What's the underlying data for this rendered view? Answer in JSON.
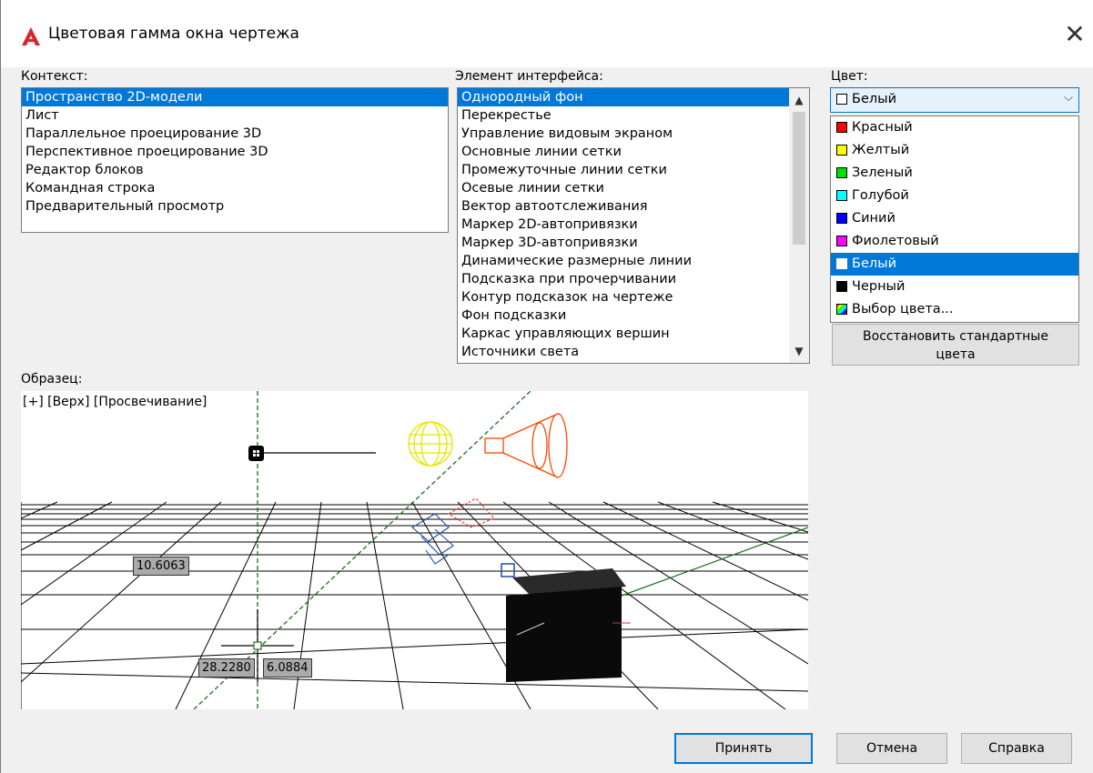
{
  "window": {
    "title": "Цветовая гамма окна чертежа",
    "close_glyph": "✕",
    "app_icon": "autocad-logo-icon",
    "accent": "#0078d7"
  },
  "context": {
    "label": "Контекст:",
    "items": [
      "Пространство 2D-модели",
      "Лист",
      "Параллельное проецирование 3D",
      "Перспективное проецирование 3D",
      "Редактор блоков",
      "Командная строка",
      "Предварительный просмотр"
    ],
    "selected_index": 0
  },
  "interface_element": {
    "label": "Элемент интерфейса:",
    "items": [
      "Однородный фон",
      "Перекрестье",
      "Управление видовым экраном",
      "Основные линии сетки",
      "Промежуточные линии сетки",
      "Осевые линии сетки",
      "Вектор автоотслеживания",
      "Маркер 2D-автопривязки",
      "Маркер 3D-автопривязки",
      "Динамические размерные линии",
      "Подсказка при прочерчивании",
      "Контур подсказок на чертеже",
      "Фон подсказки",
      "Каркас управляющих вершин",
      "Источники света"
    ],
    "selected_index": 0
  },
  "color": {
    "label": "Цвет:",
    "selected_value": "Белый",
    "options": [
      {
        "name": "Красный",
        "color": "#ff0000"
      },
      {
        "name": "Желтый",
        "color": "#ffff00"
      },
      {
        "name": "Зеленый",
        "color": "#00e000"
      },
      {
        "name": "Голубой",
        "color": "#00ffff"
      },
      {
        "name": "Синий",
        "color": "#0000ff"
      },
      {
        "name": "Фиолетовый",
        "color": "#ff00ff"
      },
      {
        "name": "Белый",
        "color": "#ffffff"
      },
      {
        "name": "Черный",
        "color": "#000000"
      },
      {
        "name": "Выбор цвета...",
        "color": "multicolor"
      }
    ],
    "highlighted_index": 6
  },
  "restore_button": {
    "line1": "Восстановить стандартные",
    "line2": "цвета"
  },
  "preview": {
    "label": "Образец:",
    "viewport_label": "[+] [Верх] [Просвечивание]",
    "coords": {
      "left_value": "10.6063",
      "bottom_x": "28.2280",
      "bottom_y": "6.0884"
    }
  },
  "buttons": {
    "accept": "Принять",
    "cancel": "Отмена",
    "help": "Справка"
  }
}
